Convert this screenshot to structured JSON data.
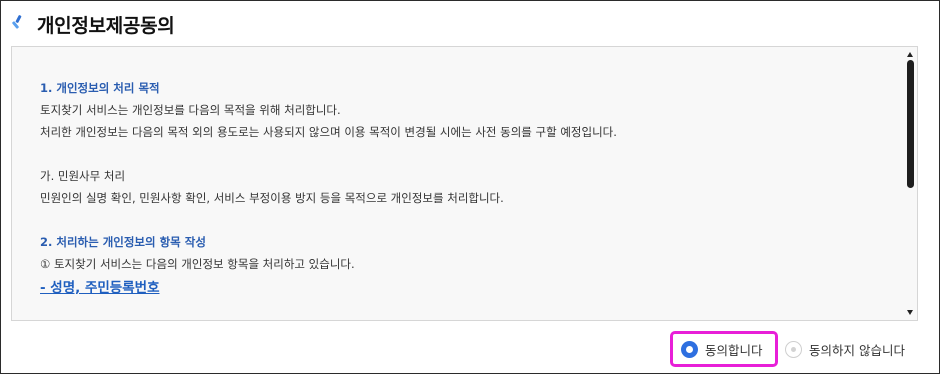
{
  "header": {
    "icon": "brand-logo-icon",
    "title": "개인정보제공동의"
  },
  "terms": {
    "section1_heading": "1. 개인정보의 처리 목적",
    "section1_line1": "토지찾기 서비스는 개인정보를 다음의 목적을 위해 처리합니다.",
    "section1_line2": "처리한 개인정보는 다음의 목적 외의 용도로는 사용되지 않으며 이용 목적이 변경될 시에는 사전 동의를 구할 예정입니다.",
    "sub_heading": "가. 민원사무 처리",
    "sub_line": "민원인의 실명 확인, 민원사항 확인, 서비스 부정이용 방지 등을 목적으로 개인정보를 처리합니다.",
    "section2_heading": "2. 처리하는 개인정보의 항목 작성",
    "section2_line1": "① 토지찾기 서비스는 다음의 개인정보 항목을 처리하고 있습니다.",
    "section2_link": "- 성명, 주민등록번호"
  },
  "consent": {
    "agree_label": "동의합니다",
    "agree_selected": true,
    "disagree_label": "동의하지 않습니다",
    "disagree_selected": false,
    "highlight_color": "#e81fd8",
    "radio_color": "#2e6fe0"
  }
}
